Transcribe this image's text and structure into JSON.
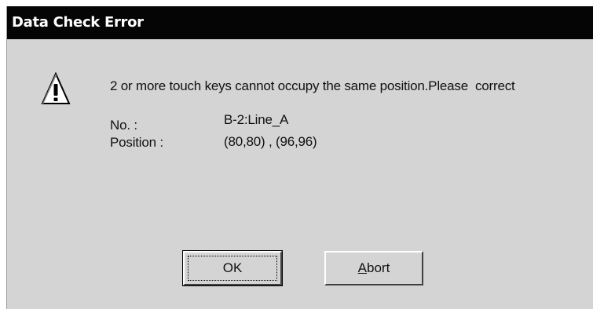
{
  "dialog": {
    "title": "Data Check Error",
    "icon": "warning-icon",
    "message": "2 or more touch keys cannot occupy the same position.Please  correct",
    "fields": {
      "no_label": "No. :",
      "no_value": "B-2:Line_A",
      "position_label": "Position :",
      "position_value": "(80,80) , (96,96)"
    },
    "buttons": {
      "ok_label": "OK",
      "abort_first": "A",
      "abort_rest": "bort"
    }
  }
}
